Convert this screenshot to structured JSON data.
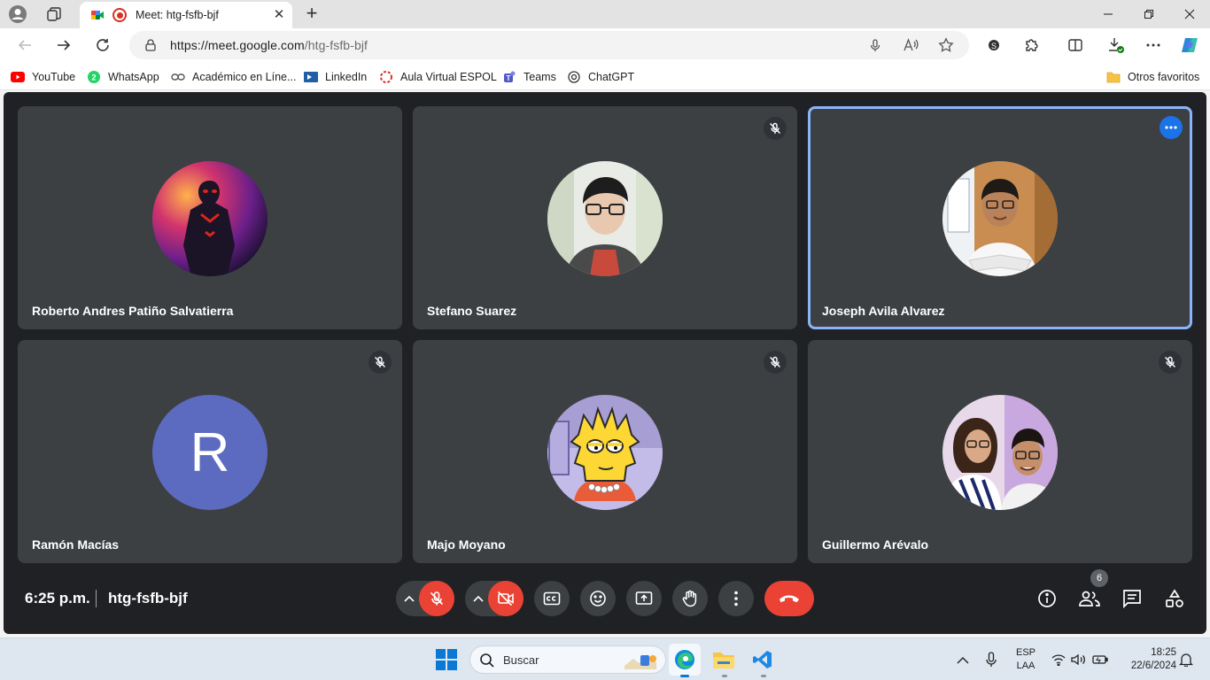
{
  "browser": {
    "tab_title": "Meet: htg-fsfb-bjf",
    "url_host": "https://meet.google.com",
    "url_path": "/htg-fsfb-bjf",
    "bookmarks": [
      "YouTube",
      "WhatsApp",
      "Académico en Líne...",
      "LinkedIn",
      "Aula Virtual ESPOL",
      "Teams",
      "ChatGPT"
    ],
    "other_favorites": "Otros favoritos"
  },
  "meet": {
    "participants": [
      {
        "name": "Roberto Andres Patiño Salvatierra",
        "muted": false,
        "avatar": "spider-man-photo"
      },
      {
        "name": "Stefano Suarez",
        "muted": true,
        "avatar": "person-photo"
      },
      {
        "name": "Joseph Avila Alvarez",
        "muted": false,
        "avatar": "person-photo",
        "active_speaker": true
      },
      {
        "name": "Ramón Macías",
        "muted": true,
        "avatar_letter": "R"
      },
      {
        "name": "Majo Moyano",
        "muted": true,
        "avatar": "lisa-simpson-cartoon"
      },
      {
        "name": "Guillermo Arévalo",
        "muted": true,
        "avatar": "couple-photo"
      }
    ],
    "clock": "6:25 p.m.",
    "meeting_code": "htg-fsfb-bjf",
    "people_count": "6"
  },
  "taskbar": {
    "search_placeholder": "Buscar",
    "lang_top": "ESP",
    "lang_bottom": "LAA",
    "time": "18:25",
    "date": "22/6/2024"
  },
  "colors": {
    "meet_bg": "#202124",
    "tile_bg": "#3c4043",
    "danger": "#ea4335",
    "accent": "#1a73e8",
    "active_border": "#8ab4f8"
  }
}
